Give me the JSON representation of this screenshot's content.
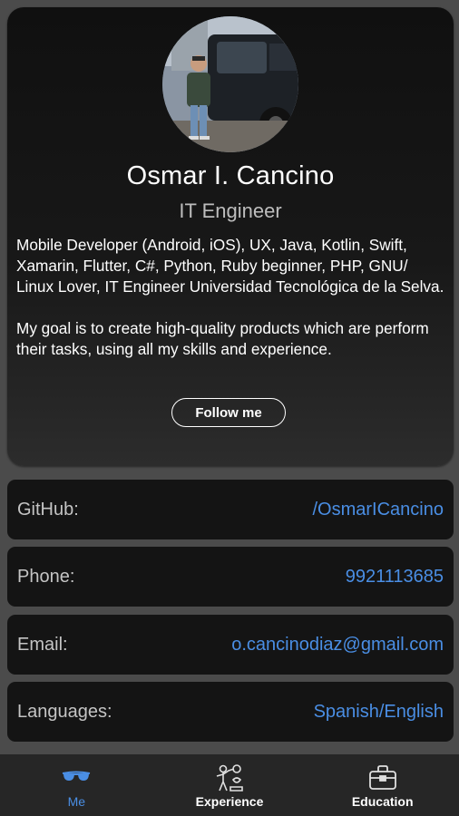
{
  "profile": {
    "name": "Osmar I. Cancino",
    "role": "IT Engineer",
    "bio": "Mobile Developer (Android, iOS), UX, Java, Kotlin, Swift, Xamarin, Flutter, C#, Python, Ruby beginner, PHP, GNU/ Linux Lover, IT Engineer Universidad Tecnológica de la Selva.\n\nMy goal is to create high-quality products which are perform their tasks, using all my skills and experience.",
    "follow_label": "Follow me"
  },
  "contacts": [
    {
      "label": "GitHub:",
      "value": "/OsmarICancino"
    },
    {
      "label": "Phone:",
      "value": "9921113685"
    },
    {
      "label": "Email:",
      "value": "o.cancinodiaz@gmail.com"
    },
    {
      "label": "Languages:",
      "value": "Spanish/English"
    }
  ],
  "nav": {
    "items": [
      {
        "label": "Me",
        "icon": "glasses-icon",
        "active": true
      },
      {
        "label": "Experience",
        "icon": "weightlifter-icon",
        "active": false
      },
      {
        "label": "Education",
        "icon": "briefcase-icon",
        "active": false
      }
    ]
  },
  "colors": {
    "accent": "#4a8ee4",
    "background": "#4b4b4b",
    "card": "#141414",
    "nav_background": "#262626"
  }
}
